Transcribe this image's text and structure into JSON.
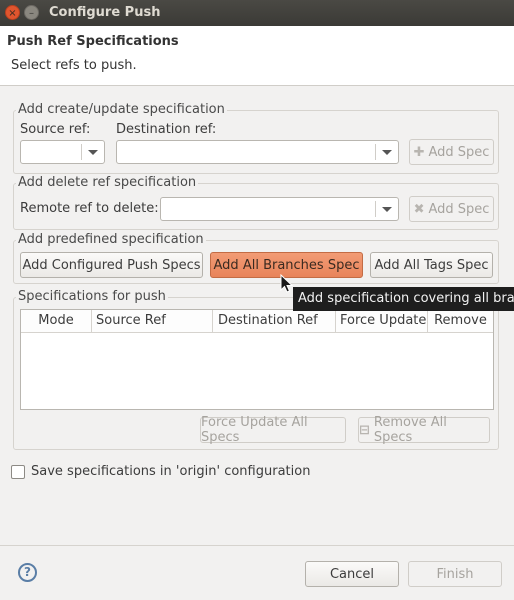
{
  "window": {
    "title": "Configure Push"
  },
  "header": {
    "title": "Push Ref Specifications",
    "subtitle": "Select refs to push."
  },
  "create_update": {
    "group_label": "Add create/update specification",
    "source_label": "Source ref:",
    "destination_label": "Destination ref:",
    "source_value": "",
    "destination_value": "",
    "add_button": "Add Spec"
  },
  "delete": {
    "group_label": "Add delete ref specification",
    "remote_label": "Remote ref to delete:",
    "remote_value": "",
    "add_button": "Add Spec"
  },
  "predefined": {
    "group_label": "Add predefined specification",
    "configured_button": "Add Configured Push Specs",
    "all_branches_button": "Add All Branches Spec",
    "all_tags_button": "Add All Tags Spec"
  },
  "tooltip": {
    "text": "Add specification covering all branches"
  },
  "specs": {
    "group_label": "Specifications for push",
    "columns": [
      "Mode",
      "Source Ref",
      "Destination Ref",
      "Force Update",
      "Remove"
    ],
    "rows": [],
    "force_all_button": "Force Update All Specs",
    "remove_all_button": "Remove All Specs"
  },
  "save_config": {
    "label": "Save specifications in 'origin' configuration",
    "checked": false
  },
  "footer": {
    "help_icon": "?",
    "cancel_button": "Cancel",
    "finish_button": "Finish"
  },
  "icons": {
    "close": "×",
    "minimize": "–",
    "add_spec": "plus-icon",
    "delete_spec": "x-icon",
    "remove_all": "remove-icon"
  },
  "colors": {
    "accent_button": "#e8845a",
    "titlebar": "#3b3a36",
    "tooltip_bg": "#1e1e1e"
  }
}
